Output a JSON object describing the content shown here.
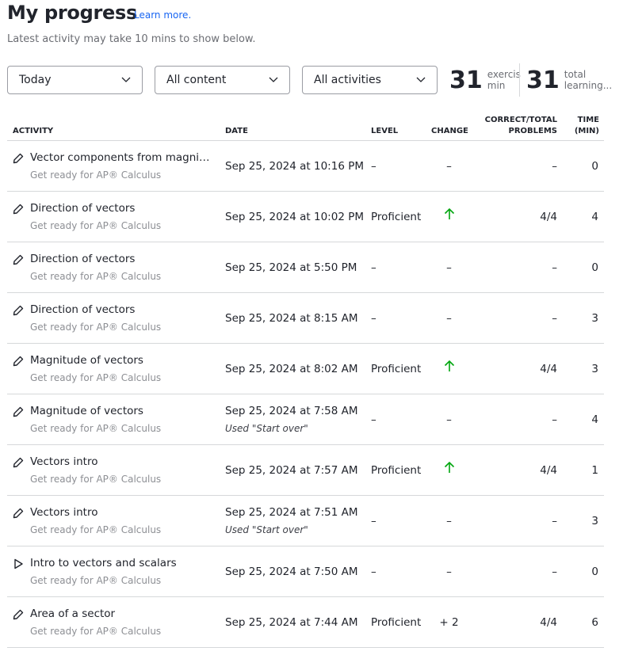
{
  "header": {
    "title": "My progress",
    "learn_more": "Learn more.",
    "subtitle": "Latest activity may take 10 mins to show below."
  },
  "filters": [
    {
      "value": "Today"
    },
    {
      "value": "All content"
    },
    {
      "value": "All activities"
    }
  ],
  "stats": [
    {
      "value": "31",
      "label1": "exercise",
      "label2": "min"
    },
    {
      "value": "31",
      "label1": "total",
      "label2": "learning..."
    }
  ],
  "columns": {
    "activity": "ACTIVITY",
    "date": "DATE",
    "level": "LEVEL",
    "change": "CHANGE",
    "correct1": "CORRECT/TOTAL",
    "correct2": "PROBLEMS",
    "time1": "TIME",
    "time2": "(MIN)"
  },
  "colors": {
    "accent": "#1865f2",
    "up_arrow": "#00a60e"
  },
  "rows": [
    {
      "icon": "pencil",
      "title": "Vector components from magnitude and direction",
      "course": "Get ready for AP® Calculus",
      "date": "Sep 25, 2024 at 10:16 PM",
      "note": "",
      "level": "–",
      "change": "–",
      "correct": "–",
      "time": "0"
    },
    {
      "icon": "pencil",
      "title": "Direction of vectors",
      "course": "Get ready for AP® Calculus",
      "date": "Sep 25, 2024 at 10:02 PM",
      "note": "",
      "level": "Proficient",
      "change": "up-arrow",
      "correct": "4/4",
      "time": "4"
    },
    {
      "icon": "pencil",
      "title": "Direction of vectors",
      "course": "Get ready for AP® Calculus",
      "date": "Sep 25, 2024 at 5:50 PM",
      "note": "",
      "level": "–",
      "change": "–",
      "correct": "–",
      "time": "0"
    },
    {
      "icon": "pencil",
      "title": "Direction of vectors",
      "course": "Get ready for AP® Calculus",
      "date": "Sep 25, 2024 at 8:15 AM",
      "note": "",
      "level": "–",
      "change": "–",
      "correct": "–",
      "time": "3"
    },
    {
      "icon": "pencil",
      "title": "Magnitude of vectors",
      "course": "Get ready for AP® Calculus",
      "date": "Sep 25, 2024 at 8:02 AM",
      "note": "",
      "level": "Proficient",
      "change": "up-arrow",
      "correct": "4/4",
      "time": "3"
    },
    {
      "icon": "pencil",
      "title": "Magnitude of vectors",
      "course": "Get ready for AP® Calculus",
      "date": "Sep 25, 2024 at 7:58 AM",
      "note": "Used \"Start over\"",
      "level": "–",
      "change": "–",
      "correct": "–",
      "time": "4"
    },
    {
      "icon": "pencil",
      "title": "Vectors intro",
      "course": "Get ready for AP® Calculus",
      "date": "Sep 25, 2024 at 7:57 AM",
      "note": "",
      "level": "Proficient",
      "change": "up-arrow",
      "correct": "4/4",
      "time": "1"
    },
    {
      "icon": "pencil",
      "title": "Vectors intro",
      "course": "Get ready for AP® Calculus",
      "date": "Sep 25, 2024 at 7:51 AM",
      "note": "Used \"Start over\"",
      "level": "–",
      "change": "–",
      "correct": "–",
      "time": "3"
    },
    {
      "icon": "play",
      "title": "Intro to vectors and scalars",
      "course": "Get ready for AP® Calculus",
      "date": "Sep 25, 2024 at 7:50 AM",
      "note": "",
      "level": "–",
      "change": "–",
      "correct": "–",
      "time": "0"
    },
    {
      "icon": "pencil",
      "title": "Area of a sector",
      "course": "Get ready for AP® Calculus",
      "date": "Sep 25, 2024 at 7:44 AM",
      "note": "",
      "level": "Proficient",
      "change": "+ 2",
      "correct": "4/4",
      "time": "6"
    }
  ]
}
